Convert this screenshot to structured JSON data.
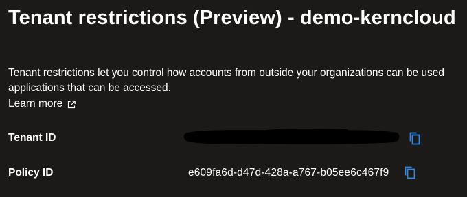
{
  "header": {
    "title": "Tenant restrictions (Preview) - demo-kerncloud"
  },
  "description": {
    "line1": "Tenant restrictions let you control how accounts from outside your organizations can be used",
    "line2": "applications that can be accessed."
  },
  "learn_more": {
    "label": "Learn more",
    "icon": "external-link-icon"
  },
  "fields": {
    "tenant_id": {
      "label": "Tenant ID",
      "value_redacted": true,
      "copy_icon": "copy-icon"
    },
    "policy_id": {
      "label": "Policy ID",
      "value": "e609fa6d-d47d-428a-a767-b05ee6c467f9",
      "copy_icon": "copy-icon"
    }
  },
  "colors": {
    "background": "#1b1a19",
    "text": "#ffffff",
    "accent": "#2f8be6",
    "redaction": "#000000"
  }
}
